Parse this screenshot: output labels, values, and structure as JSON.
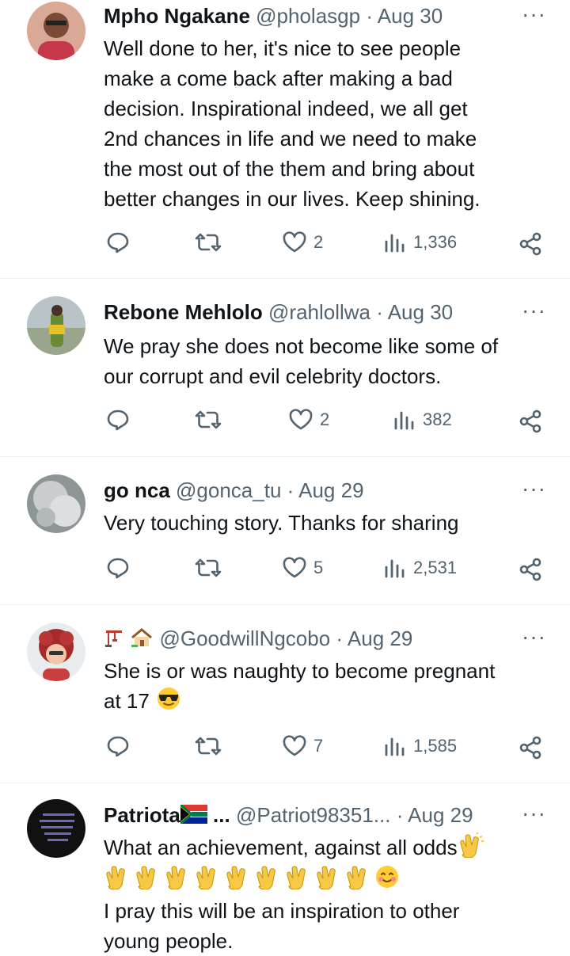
{
  "colors": {
    "text": "#0f1419",
    "muted": "#536471",
    "divider": "#eff3f4"
  },
  "tweets": [
    {
      "name": "Mpho Ngakane",
      "handle": "@pholasgp",
      "dot": "·",
      "date": "Aug 30",
      "more": "···",
      "lines": [
        "Well done to her, it's nice to see people",
        "make a come back after making a bad",
        "decision. Inspirational indeed, we all get",
        "2nd chances in life and we need to make",
        "the most out of the them and bring about",
        "better changes in our lives. Keep shining."
      ],
      "likes": "2",
      "views": "1,336"
    },
    {
      "name": "Rebone Mehlolo",
      "handle": "@rahlollwa",
      "dot": "·",
      "date": "Aug 30",
      "more": "···",
      "lines": [
        "We pray she does not become like some of",
        "our corrupt and evil celebrity doctors."
      ],
      "likes": "2",
      "views": "382"
    },
    {
      "name": "go nca",
      "handle": "@gonca_tu",
      "dot": "·",
      "date": "Aug 29",
      "more": "···",
      "lines": [
        "Very touching story. Thanks for sharing"
      ],
      "likes": "5",
      "views": "2,531"
    },
    {
      "name_emoji": [
        "crane-emoji",
        "house-emoji"
      ],
      "handle": "@GoodwillNgcobo",
      "dot": "·",
      "date": "Aug 29",
      "more": "···",
      "lines": [
        "She is or was naughty to become pregnant",
        "at 17"
      ],
      "line_emoji": "sunglasses-emoji",
      "likes": "7",
      "views": "1,585"
    },
    {
      "name": "Patriota",
      "name_suffix": "...",
      "name_emoji": "south-africa-flag-emoji",
      "handle": "@Patriot98351...",
      "dot": "·",
      "date": "Aug 29",
      "more": "···",
      "lines": [
        "What an achievement, against all odds",
        "I pray this will be an inspiration to other",
        "young people."
      ],
      "clap_count": 9
    }
  ]
}
